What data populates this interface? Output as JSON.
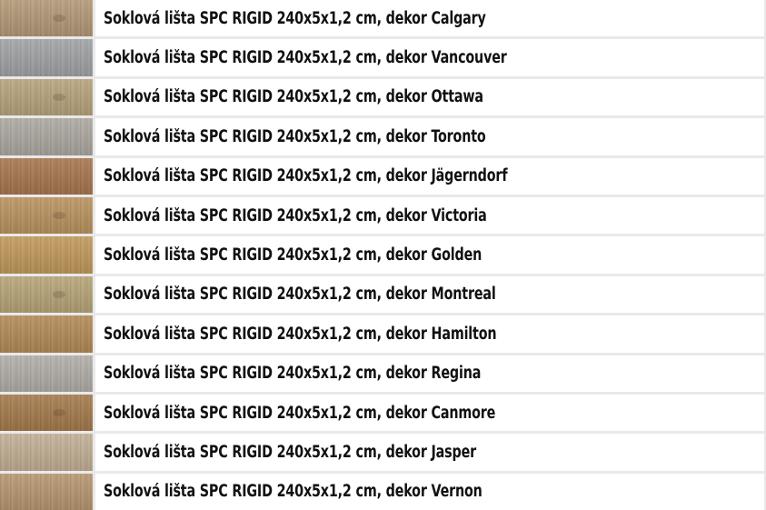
{
  "products": [
    {
      "label": "Soklová lišta SPC RIGID 240x5x1,2 cm, dekor Calgary",
      "swatch_color": "#b59a78"
    },
    {
      "label": "Soklová lišta SPC RIGID 240x5x1,2 cm, dekor Vancouver",
      "swatch_color": "#a3a4a6"
    },
    {
      "label": "Soklová lišta SPC RIGID 240x5x1,2 cm, dekor Ottawa",
      "swatch_color": "#b8a57d"
    },
    {
      "label": "Soklová lišta SPC RIGID 240x5x1,2 cm, dekor Toronto",
      "swatch_color": "#aea9a2"
    },
    {
      "label": "Soklová lišta SPC RIGID 240x5x1,2 cm, dekor Jägerndorf",
      "swatch_color": "#a8774f"
    },
    {
      "label": "Soklová lišta SPC RIGID 240x5x1,2 cm, dekor Victoria",
      "swatch_color": "#bb9460"
    },
    {
      "label": "Soklová lišta SPC RIGID 240x5x1,2 cm, dekor Golden",
      "swatch_color": "#c39a5c"
    },
    {
      "label": "Soklová lišta SPC RIGID 240x5x1,2 cm, dekor Montreal",
      "swatch_color": "#b8a679"
    },
    {
      "label": "Soklová lišta SPC RIGID 240x5x1,2 cm, dekor Hamilton",
      "swatch_color": "#b48c58"
    },
    {
      "label": "Soklová lišta SPC RIGID 240x5x1,2 cm, dekor Regina",
      "swatch_color": "#b3afaa"
    },
    {
      "label": "Soklová lišta SPC RIGID 240x5x1,2 cm, dekor Canmore",
      "swatch_color": "#a67b4c"
    },
    {
      "label": "Soklová lišta SPC RIGID 240x5x1,2 cm, dekor Jasper",
      "swatch_color": "#c4b196"
    },
    {
      "label": "Soklová lišta SPC RIGID 240x5x1,2 cm, dekor Vernon",
      "swatch_color": "#b89871"
    }
  ]
}
